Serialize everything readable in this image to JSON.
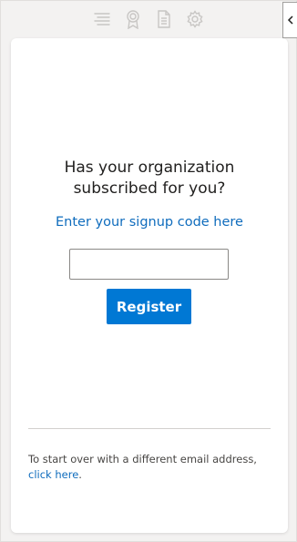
{
  "toolbar": {
    "icons": [
      "list-icon",
      "award-icon",
      "document-icon",
      "gear-icon"
    ],
    "collapse_icon": "chevron-left-icon"
  },
  "card": {
    "heading_line1": "Has your organization",
    "heading_line2": "subscribed for you?",
    "signup_link": "Enter your signup code here",
    "code_input_value": "",
    "code_input_placeholder": "",
    "register_label": "Register",
    "footer_text": "To start over with a different email address,",
    "footer_link": "click here",
    "footer_end": "."
  },
  "colors": {
    "accent": "#0078d4",
    "link": "#0f6cbd",
    "background": "#f3f2f1"
  }
}
